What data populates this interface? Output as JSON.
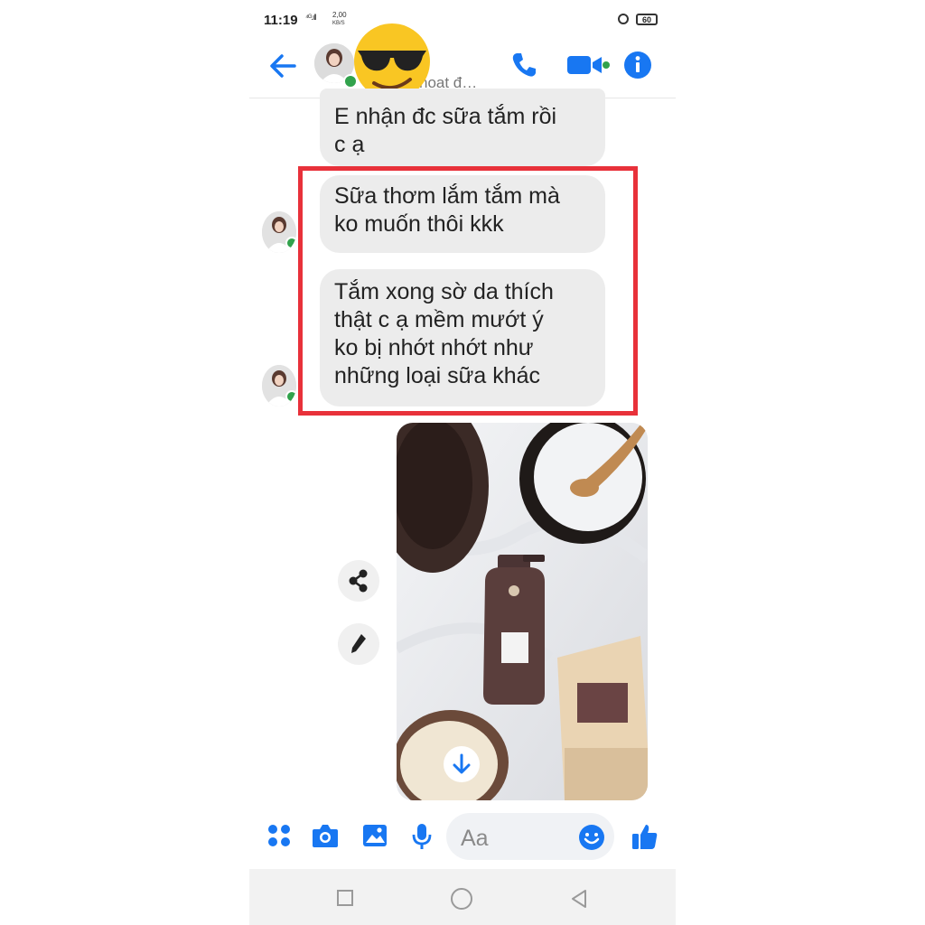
{
  "status_bar": {
    "time": "11:19",
    "signal": "⁴ᴳ.ıll",
    "net_speed_value": "2,00",
    "net_speed_unit": "KB/S",
    "battery": "60"
  },
  "header": {
    "contact_status": "hoạt đ…",
    "emoji": "😎",
    "accent_color": "#1877f2"
  },
  "messages": [
    {
      "lines": [
        "E nhận đc sữa tắm rồi",
        "c ạ"
      ]
    },
    {
      "lines": [
        "Sữa thơm lắm tắm mà",
        "ko muốn thôi kkk"
      ]
    },
    {
      "lines": [
        "Tắm xong sờ da thích",
        "thật c ạ mềm mướt ý",
        "ko bị nhớt nhớt như",
        "những loại sữa khác"
      ]
    }
  ],
  "highlight_color": "#e8313a",
  "composer": {
    "placeholder": "Aa"
  },
  "icons": {
    "back": "back-arrow-icon",
    "call": "phone-icon",
    "video": "video-camera-icon",
    "info": "info-icon",
    "share": "share-icon",
    "edit": "pencil-icon",
    "download": "download-arrow-icon",
    "menu": "four-dots-icon",
    "camera": "camera-icon",
    "gallery": "image-icon",
    "mic": "microphone-icon",
    "emoji": "smiley-icon",
    "like": "thumbs-up-icon"
  }
}
